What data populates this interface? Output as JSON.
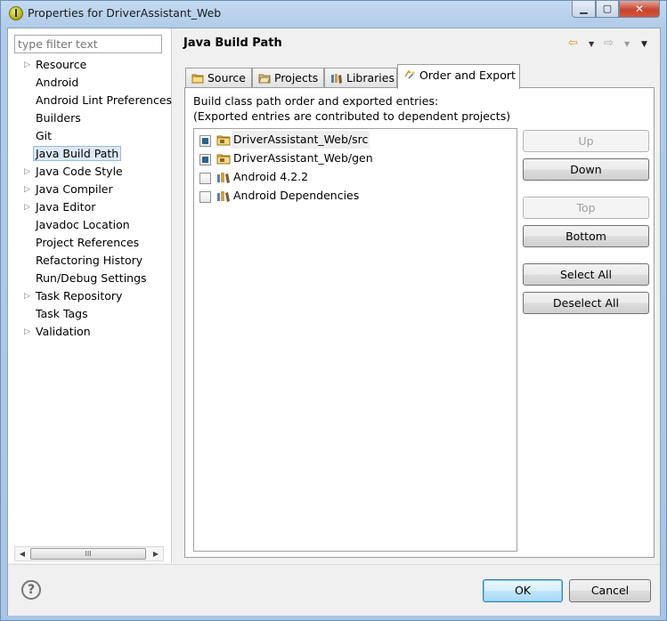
{
  "window": {
    "title": "Properties for DriverAssistant_Web",
    "minimize_glyph": "▁",
    "maximize_glyph": "▢",
    "close_glyph": "✕"
  },
  "sidebar": {
    "filter_placeholder": "type filter text",
    "items": [
      {
        "label": "Resource",
        "expandable": true
      },
      {
        "label": "Android",
        "expandable": false
      },
      {
        "label": "Android Lint Preferences",
        "expandable": false
      },
      {
        "label": "Builders",
        "expandable": false
      },
      {
        "label": "Git",
        "expandable": false
      },
      {
        "label": "Java Build Path",
        "expandable": false,
        "selected": true
      },
      {
        "label": "Java Code Style",
        "expandable": true
      },
      {
        "label": "Java Compiler",
        "expandable": true
      },
      {
        "label": "Java Editor",
        "expandable": true
      },
      {
        "label": "Javadoc Location",
        "expandable": false
      },
      {
        "label": "Project References",
        "expandable": false
      },
      {
        "label": "Refactoring History",
        "expandable": false
      },
      {
        "label": "Run/Debug Settings",
        "expandable": false
      },
      {
        "label": "Task Repository",
        "expandable": true
      },
      {
        "label": "Task Tags",
        "expandable": false
      },
      {
        "label": "Validation",
        "expandable": true
      }
    ],
    "scroll_left": "◀",
    "scroll_right": "▶",
    "scroll_grip": "III"
  },
  "page": {
    "title": "Java Build Path",
    "nav": {
      "back_icon": "arrow-left-icon",
      "forward_icon": "arrow-right-icon",
      "back_glyph": "⇦",
      "forward_glyph": "⇨",
      "dropdown_glyph": "▼"
    },
    "tabs": [
      {
        "label": "Source",
        "icon": "source-folder-icon"
      },
      {
        "label": "Projects",
        "icon": "projects-folder-icon"
      },
      {
        "label": "Libraries",
        "icon": "libraries-icon"
      },
      {
        "label": "Order and Export",
        "icon": "order-export-icon",
        "active": true
      }
    ],
    "description_line1": "Build class path order and exported entries:",
    "description_line2": "(Exported entries are contributed to dependent projects)",
    "entries": [
      {
        "label": "DriverAssistant_Web/src",
        "checked": true,
        "icon": "source-folder-icon"
      },
      {
        "label": "DriverAssistant_Web/gen",
        "checked": true,
        "icon": "source-folder-icon"
      },
      {
        "label": "Android 4.2.2",
        "checked": false,
        "icon": "library-icon"
      },
      {
        "label": "Android Dependencies",
        "checked": false,
        "icon": "library-icon"
      }
    ],
    "buttons": {
      "up": "Up",
      "down": "Down",
      "top": "Top",
      "bottom": "Bottom",
      "select_all": "Select All",
      "deselect_all": "Deselect All"
    }
  },
  "footer": {
    "help_glyph": "?",
    "ok": "OK",
    "cancel": "Cancel"
  }
}
